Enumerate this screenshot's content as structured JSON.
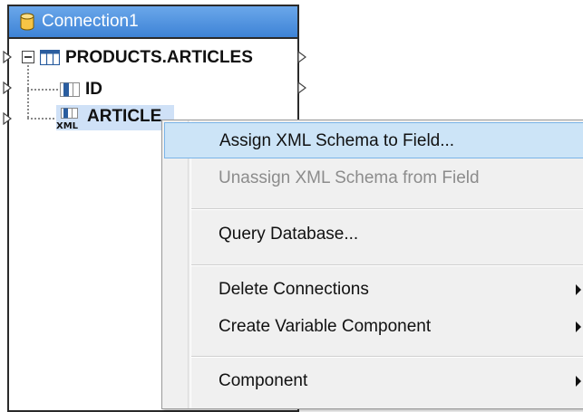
{
  "component": {
    "title": "Connection1",
    "rows": [
      {
        "label": "PRODUCTS.ARTICLES"
      },
      {
        "label": "ID"
      },
      {
        "label": "ARTICLE",
        "badge": "XML"
      }
    ]
  },
  "context_menu": {
    "items": [
      {
        "label": "Assign XML Schema to Field...",
        "state": "highlighted"
      },
      {
        "label": "Unassign XML Schema from Field",
        "state": "disabled"
      },
      {
        "label": "Query Database..."
      },
      {
        "label": "Delete Connections",
        "submenu": true
      },
      {
        "label": "Create Variable Component",
        "submenu": true
      },
      {
        "label": "Component",
        "submenu": true
      }
    ]
  },
  "colors": {
    "header_blue": "#3e83d6",
    "highlight_bg": "#cce4f7",
    "selected_row_bg": "#cfe1f7"
  }
}
